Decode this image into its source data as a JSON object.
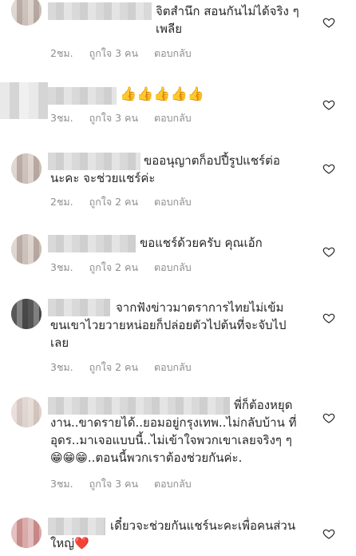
{
  "comments": [
    {
      "text": "จิตสำนึก สอนกันไม่ได้จริง ๆ เพลีย",
      "time": "2ชม.",
      "likes": "ถูกใจ 3 คน",
      "reply": "ตอบกลับ"
    },
    {
      "text": "👍👍👍👍👍",
      "time": "3ชม.",
      "likes": "ถูกใจ 3 คน",
      "reply": "ตอบกลับ"
    },
    {
      "text": "ขออนุญาตก็อปปี้รูปแชร์ต่อ นะคะ จะช่วยแชร์ค่ะ",
      "time": "2ชม.",
      "likes": "ถูกใจ 2 คน",
      "reply": "ตอบกลับ"
    },
    {
      "text": "ขอแชร์ด้วยครับ คุณเอ้ก",
      "time": "3ชม.",
      "likes": "ถูกใจ 2 คน",
      "reply": "ตอบกลับ"
    },
    {
      "text": "จากฟังข่าวมาตราการไทยไม่เข้ม ขนเขาไวยวายหน่อยก็ปล่อยตัวไปต้นที่จะจับไป เลย",
      "time": "3ชม.",
      "likes": "ถูกใจ 2 คน",
      "reply": "ตอบกลับ"
    },
    {
      "text": "พี่ก็ต้องหยุด งาน..ขาดรายได้..ยอมอยู่กรุงเทพ..ไม่กลับบ้าน ที่อุดร..มาเจอแบบนี้..ไม่เข้าใจพวกเขาเลยจริงๆ ๆ😁😁😁..ตอนนี้พวกเราต้องช่วยกันค่ะ.",
      "time": "3ชม.",
      "likes": "ถูกใจ 3 คน",
      "reply": "ตอบกลับ"
    },
    {
      "text": "เดี๋ยวจะช่วยกันแชร์นะคะเพื่อคนส่วน ใหญ่❤️",
      "time": "",
      "likes": "",
      "reply": ""
    }
  ],
  "icons": {
    "like": "heart-outline-icon"
  }
}
